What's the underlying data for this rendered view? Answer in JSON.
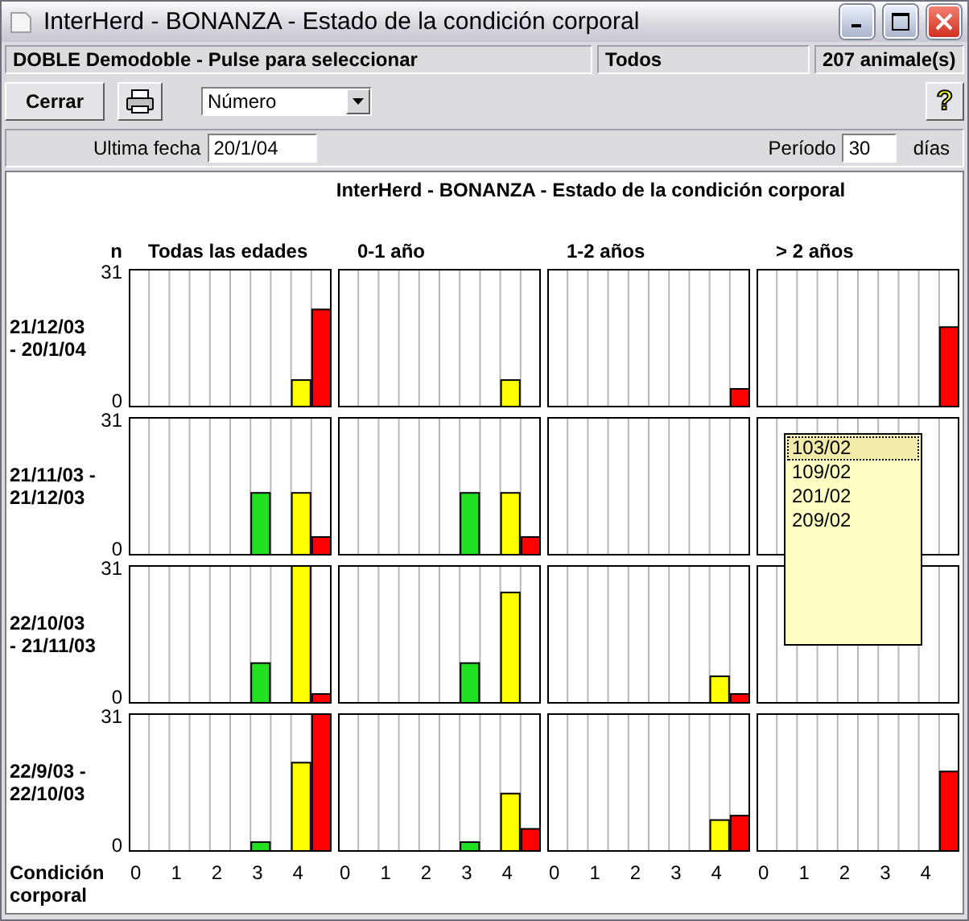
{
  "window": {
    "title": "InterHerd - BONANZA - Estado de la condición corporal"
  },
  "status_bar": [
    "DOBLE Demodoble - Pulse para seleccionar",
    "Todos",
    "207 animale(s)"
  ],
  "toolbar": {
    "close_button": "Cerrar",
    "sort_select": "Número",
    "help_button": "?"
  },
  "filters": {
    "last_date_label": "Ultima fecha",
    "last_date": "20/1/04",
    "period_label": "Período",
    "period": "30",
    "period_unit": "días"
  },
  "report": {
    "title": "InterHerd - BONANZA - Estado de la condición corporal",
    "y_axis_label": "n",
    "x_axis_label": "Condición corporal",
    "columns": [
      {
        "title": "Todas las edades",
        "x_ticks": [
          "0",
          "1",
          "2",
          "3",
          "4"
        ]
      },
      {
        "title": "0-1 año",
        "x_ticks": [
          "0",
          "1",
          "2",
          "3",
          "4"
        ]
      },
      {
        "title": "1-2 años",
        "x_ticks": [
          "0",
          "1",
          "2",
          "3",
          "4"
        ]
      },
      {
        "title": "> 2 años",
        "x_ticks": [
          "0",
          "1",
          "2",
          "3",
          "4"
        ]
      }
    ],
    "rows": [
      {
        "period": "21/12/03 - 20/1/04",
        "y_ticks": [
          "31",
          "0"
        ]
      },
      {
        "period": "21/11/03 - 21/12/03",
        "y_ticks": [
          "31",
          "0"
        ]
      },
      {
        "period": "22/10/03 - 21/11/03",
        "y_ticks": [
          "31",
          "0"
        ]
      },
      {
        "period": "22/9/03 - 22/10/03",
        "y_ticks": [
          "31",
          "0"
        ]
      }
    ],
    "popup": {
      "items": [
        {
          "label": "103/02",
          "selected": true
        },
        {
          "label": "109/02",
          "selected": false
        },
        {
          "label": "201/02",
          "selected": false
        },
        {
          "label": "209/02",
          "selected": false
        }
      ]
    }
  }
}
